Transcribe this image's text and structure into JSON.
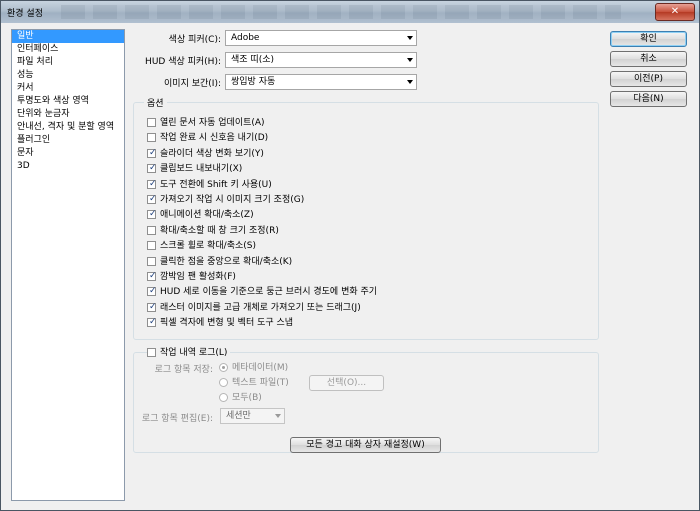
{
  "window": {
    "title": "환경 설정",
    "close_label": "✕"
  },
  "sidebar": {
    "items": [
      {
        "label": "일반",
        "selected": true
      },
      {
        "label": "인터페이스"
      },
      {
        "label": "파일 처리"
      },
      {
        "label": "성능"
      },
      {
        "label": "커서"
      },
      {
        "label": "투명도와 색상 영역"
      },
      {
        "label": "단위와 눈금자"
      },
      {
        "label": "안내선, 격자 및 분할 영역"
      },
      {
        "label": "플러그인"
      },
      {
        "label": "문자"
      },
      {
        "label": "3D"
      }
    ]
  },
  "settings": {
    "color_picker_label": "색상 피커(C):",
    "color_picker_value": "Adobe",
    "hud_picker_label": "HUD 색상 피커(H):",
    "hud_picker_value": "색조 띠(소)",
    "interp_label": "이미지 보간(I):",
    "interp_value": "쌍입방 자동"
  },
  "options": {
    "title": "옵션",
    "items": [
      {
        "label": "열린 문서 자동 업데이트(A)",
        "checked": false
      },
      {
        "label": "작업 완료 시 신호음 내기(D)",
        "checked": false
      },
      {
        "label": "슬라이더 색상 변화 보기(Y)",
        "checked": true
      },
      {
        "label": "클립보드 내보내기(X)",
        "checked": true
      },
      {
        "label": "도구 전환에 Shift 키 사용(U)",
        "checked": true
      },
      {
        "label": "가져오기 작업 시 이미지 크기 조정(G)",
        "checked": true
      },
      {
        "label": "애니메이션 확대/축소(Z)",
        "checked": true
      },
      {
        "label": "확대/축소할 때 창 크기 조정(R)",
        "checked": false
      },
      {
        "label": "스크롤 휠로 확대/축소(S)",
        "checked": false
      },
      {
        "label": "클릭한 점을 중앙으로 확대/축소(K)",
        "checked": false
      },
      {
        "label": "깜박임 팬 활성화(F)",
        "checked": true
      },
      {
        "label": "HUD 세로 이동을 기준으로 둥근 브러시 경도에 변화 주기",
        "checked": true
      },
      {
        "label": "래스터 이미지를 고급 개체로 가져오기 또는 드래그(J)",
        "checked": true
      },
      {
        "label": "픽셀 격자에 변형 및 벡터 도구 스냅",
        "checked": true
      }
    ]
  },
  "history": {
    "title": "작업 내역 로그(L)",
    "save_label": "로그 항목 저장:",
    "radios": [
      {
        "label": "메타데이터(M)",
        "selected": true
      },
      {
        "label": "텍스트 파일(T)",
        "selected": false
      },
      {
        "label": "모두(B)",
        "selected": false
      }
    ],
    "choose_button": "선택(O)...",
    "edit_label": "로그 항목 편집(E):",
    "edit_value": "세션만"
  },
  "reset_button": "모든 경고 대화 상자 재설정(W)",
  "buttons": {
    "ok": "확인",
    "cancel": "취소",
    "prev": "이전(P)",
    "next": "다음(N)"
  }
}
